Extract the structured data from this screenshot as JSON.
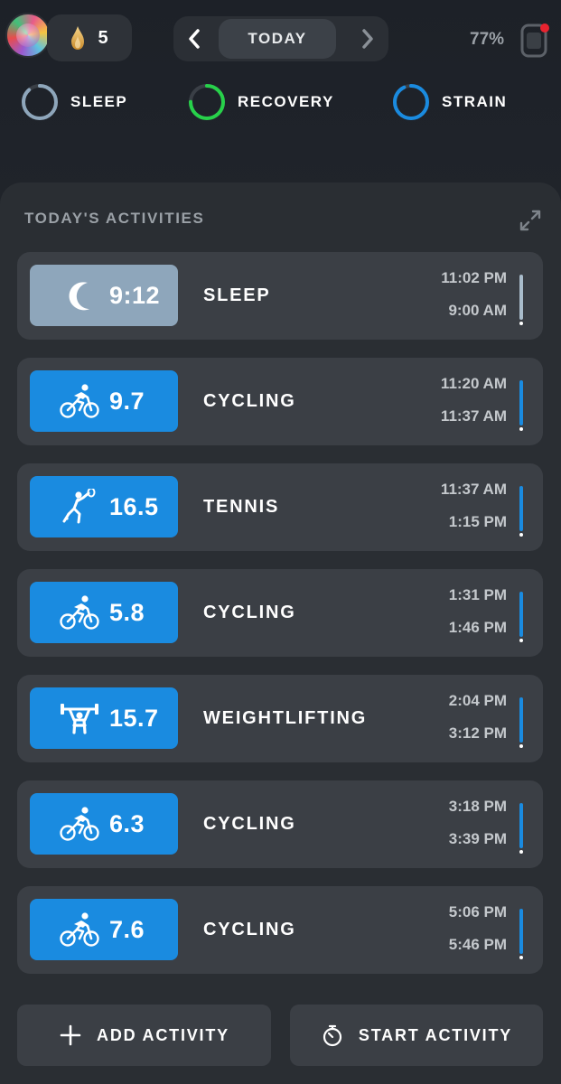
{
  "header": {
    "streak_count": "5",
    "date_label": "TODAY",
    "battery": "77%"
  },
  "metrics": [
    {
      "label": "SLEEP",
      "color": "#8ea6bb"
    },
    {
      "label": "RECOVERY",
      "color": "#27d14a"
    },
    {
      "label": "STRAIN",
      "color": "#1a8be0"
    }
  ],
  "activities_panel": {
    "title": "TODAY'S ACTIVITIES",
    "rows": [
      {
        "icon": "moon-icon",
        "value": "9:12",
        "name": "SLEEP",
        "start": "11:02 PM",
        "end": "9:00 AM"
      },
      {
        "icon": "cycling-icon",
        "value": "9.7",
        "name": "CYCLING",
        "start": "11:20 AM",
        "end": "11:37 AM"
      },
      {
        "icon": "tennis-icon",
        "value": "16.5",
        "name": "TENNIS",
        "start": "11:37 AM",
        "end": "1:15 PM"
      },
      {
        "icon": "cycling-icon",
        "value": "5.8",
        "name": "CYCLING",
        "start": "1:31 PM",
        "end": "1:46 PM"
      },
      {
        "icon": "weightlifting-icon",
        "value": "15.7",
        "name": "WEIGHTLIFTING",
        "start": "2:04 PM",
        "end": "3:12 PM"
      },
      {
        "icon": "cycling-icon",
        "value": "6.3",
        "name": "CYCLING",
        "start": "3:18 PM",
        "end": "3:39 PM"
      },
      {
        "icon": "cycling-icon",
        "value": "7.6",
        "name": "CYCLING",
        "start": "5:06 PM",
        "end": "5:46 PM"
      }
    ]
  },
  "buttons": {
    "add_activity": "ADD ACTIVITY",
    "start_activity": "START ACTIVITY"
  },
  "colors": {
    "accent_blue": "#1a8be0",
    "sleep_gray": "#8ea6bb",
    "recovery_green": "#27d14a",
    "notification_red": "#e8232f"
  }
}
